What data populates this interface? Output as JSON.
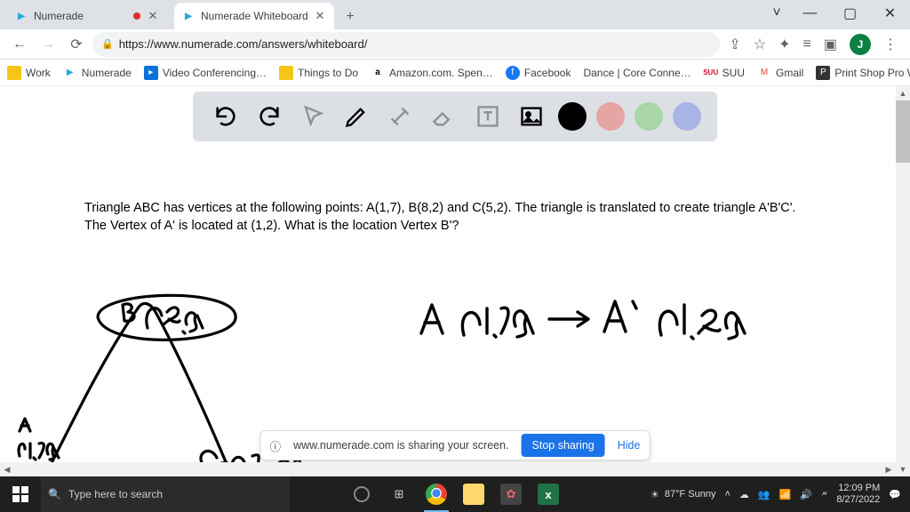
{
  "window": {
    "min": "—",
    "max": "▢",
    "close": "✕",
    "caret": "˅"
  },
  "tabs": [
    {
      "label": "Numerade",
      "recording": true
    },
    {
      "label": "Numerade Whiteboard",
      "active": true
    }
  ],
  "newtab": "+",
  "address": {
    "url": "https://www.numerade.com/answers/whiteboard/"
  },
  "toolbar_icons": {
    "share": "⇪",
    "star": "☆",
    "ext": "✦",
    "list": "≡",
    "box": "▣",
    "menu": "⋮"
  },
  "avatar_initial": "J",
  "bookmarks": [
    {
      "label": "Work",
      "color": "#f5c518"
    },
    {
      "label": "Numerade",
      "color": "#2aa8e0"
    },
    {
      "label": "Video Conferencing…",
      "color": "#0b72d9"
    },
    {
      "label": "Things to Do",
      "color": "#f5c518"
    },
    {
      "label": "Amazon.com. Spen…",
      "color": "#000"
    },
    {
      "label": "Facebook",
      "color": "#1877f2"
    },
    {
      "label": "Dance | Core Conne…",
      "color": ""
    },
    {
      "label": "SUU",
      "color": "#c8102e"
    },
    {
      "label": "Gmail",
      "color": "#ea4335"
    },
    {
      "label": "Print Shop Pro Web…",
      "color": "#333"
    }
  ],
  "bookmarks_overflow": "»",
  "whiteboard": {
    "colors": {
      "black": "#000000",
      "red": "#e6a5a5",
      "green": "#a9d6a9",
      "blue": "#a9b4e6"
    },
    "problem_line1": "Triangle ABC has vertices at the following points: A(1,7), B(8,2) and C(5,2). The triangle is translated to create triangle A'B'C'.",
    "problem_line2": "The Vertex of A' is located at (1,2). What is the location Vertex B'?"
  },
  "share": {
    "msg": "www.numerade.com is sharing your screen.",
    "stop": "Stop sharing",
    "hide": "Hide",
    "info": "ⓘ"
  },
  "taskbar": {
    "search_placeholder": "Type here to search",
    "weather": "87°F  Sunny",
    "tray_up": "˄",
    "time": "12:09 PM",
    "date": "8/27/2022",
    "notif": "💬"
  }
}
